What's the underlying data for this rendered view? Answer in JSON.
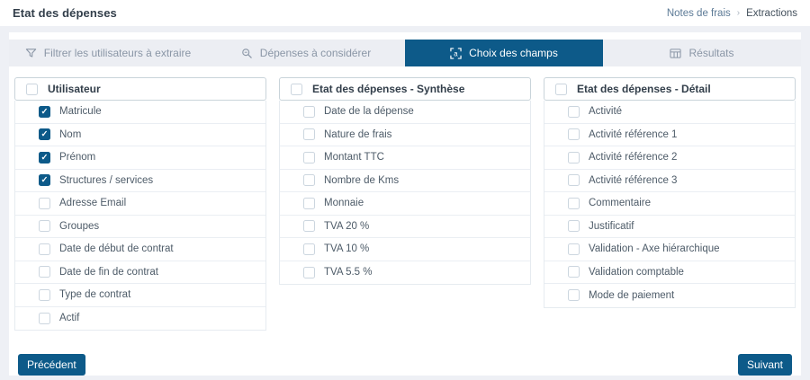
{
  "colors": {
    "accent": "#0d5a89",
    "page_background": "#eef0f5",
    "inactive_tab_background": "#eceef3"
  },
  "header": {
    "title": "Etat des dépenses",
    "breadcrumb": {
      "parent": "Notes de frais",
      "separator": "›",
      "current": "Extractions"
    }
  },
  "tabs": [
    {
      "id": "filter-users",
      "label": "Filtrer les utilisateurs à extraire",
      "icon": "filter-icon",
      "active": false
    },
    {
      "id": "expenses",
      "label": "Dépenses à considérer",
      "icon": "search-icon",
      "active": false
    },
    {
      "id": "field-choice",
      "label": "Choix des champs",
      "icon": "select-fields-icon",
      "active": true
    },
    {
      "id": "results",
      "label": "Résultats",
      "icon": "table-icon",
      "active": false
    }
  ],
  "columns": [
    {
      "id": "utilisateur",
      "header": {
        "label": "Utilisateur",
        "checked": false
      },
      "items": [
        {
          "label": "Matricule",
          "checked": true
        },
        {
          "label": "Nom",
          "checked": true
        },
        {
          "label": "Prénom",
          "checked": true
        },
        {
          "label": "Structures / services",
          "checked": true
        },
        {
          "label": "Adresse Email",
          "checked": false
        },
        {
          "label": "Groupes",
          "checked": false
        },
        {
          "label": "Date de début de contrat",
          "checked": false
        },
        {
          "label": "Date de fin de contrat",
          "checked": false
        },
        {
          "label": "Type de contrat",
          "checked": false
        },
        {
          "label": "Actif",
          "checked": false
        }
      ]
    },
    {
      "id": "synthese",
      "header": {
        "label": "Etat des dépenses - Synthèse",
        "checked": false
      },
      "items": [
        {
          "label": "Date de la dépense",
          "checked": false
        },
        {
          "label": "Nature de frais",
          "checked": false
        },
        {
          "label": "Montant TTC",
          "checked": false
        },
        {
          "label": "Nombre de Kms",
          "checked": false
        },
        {
          "label": "Monnaie",
          "checked": false
        },
        {
          "label": "TVA 20 %",
          "checked": false
        },
        {
          "label": "TVA 10 %",
          "checked": false
        },
        {
          "label": "TVA 5.5 %",
          "checked": false
        }
      ]
    },
    {
      "id": "detail",
      "header": {
        "label": "Etat des dépenses - Détail",
        "checked": false
      },
      "items": [
        {
          "label": "Activité",
          "checked": false
        },
        {
          "label": "Activité référence 1",
          "checked": false
        },
        {
          "label": "Activité référence 2",
          "checked": false
        },
        {
          "label": "Activité référence 3",
          "checked": false
        },
        {
          "label": "Commentaire",
          "checked": false
        },
        {
          "label": "Justificatif",
          "checked": false
        },
        {
          "label": "Validation - Axe hiérarchique",
          "checked": false
        },
        {
          "label": "Validation comptable",
          "checked": false
        },
        {
          "label": "Mode de paiement",
          "checked": false
        }
      ]
    }
  ],
  "footer": {
    "previous_label": "Précédent",
    "next_label": "Suivant"
  }
}
